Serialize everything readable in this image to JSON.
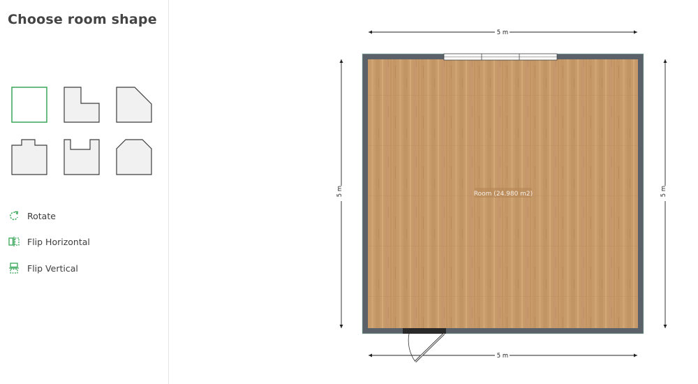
{
  "sidebar": {
    "title": "Choose room shape",
    "shapes": [
      {
        "name": "square",
        "selected": true
      },
      {
        "name": "l-shape",
        "selected": false
      },
      {
        "name": "cut-corner",
        "selected": false
      },
      {
        "name": "t-shape",
        "selected": false
      },
      {
        "name": "u-shape",
        "selected": false
      },
      {
        "name": "hexagon-top",
        "selected": false
      }
    ],
    "actions": [
      {
        "id": "rotate",
        "label": "Rotate",
        "icon": "rotate-icon"
      },
      {
        "id": "flip-horizontal",
        "label": "Flip Horizontal",
        "icon": "flip-horizontal-icon"
      },
      {
        "id": "flip-vertical",
        "label": "Flip Vertical",
        "icon": "flip-vertical-icon"
      }
    ]
  },
  "plan": {
    "room_label": "Room (24.980 m2)",
    "dim_top": "5 m",
    "dim_bottom": "5 m",
    "dim_left": "5 m",
    "dim_right": "5 m"
  },
  "colors": {
    "accent": "#3aa65a",
    "wall": "#5a6168",
    "floor": "#c79a68",
    "shape_fill": "#f1f1f1",
    "shape_stroke": "#3c3c3c"
  }
}
